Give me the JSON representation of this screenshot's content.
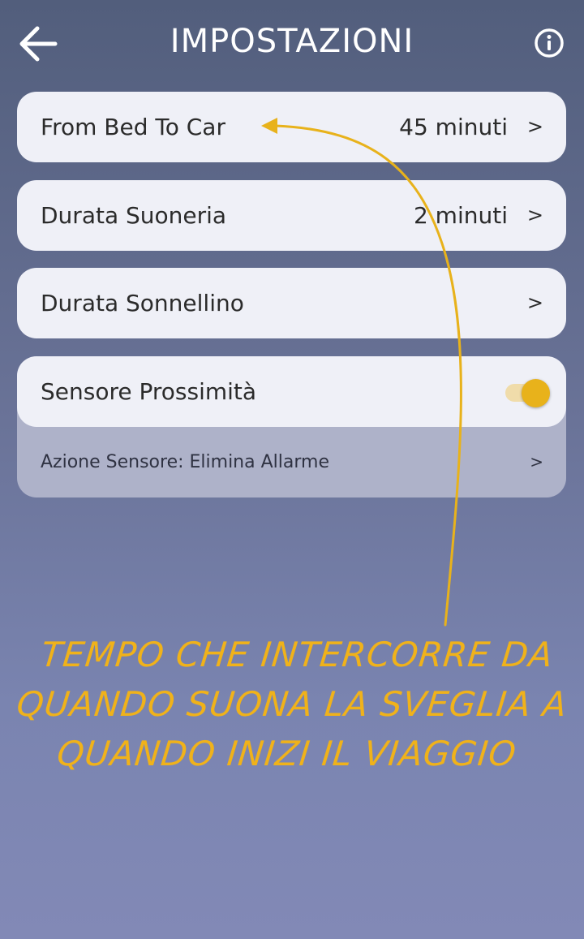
{
  "header": {
    "title": "IMPOSTAZIONI",
    "back_icon": "arrow-left-icon",
    "info_icon": "info-circle-icon"
  },
  "settings": [
    {
      "label": "From Bed To Car",
      "value": "45 minuti",
      "chevron": ">"
    },
    {
      "label": "Durata Suoneria",
      "value": "2 minuti",
      "chevron": ">"
    },
    {
      "label": "Durata Sonnellino",
      "value": "",
      "chevron": ">"
    }
  ],
  "sensor": {
    "label": "Sensore Prossimità",
    "toggle_on": true,
    "action_label": "Azione Sensore: Elimina Allarme",
    "action_chevron": ">"
  },
  "annotation": {
    "lines": [
      "TEMPO CHE INTERCORRE DA",
      "QUANDO SUONA LA SVEGLIA A",
      "QUANDO INIZI IL VIAGGIO"
    ],
    "arrow_icon": "curved-arrow-icon"
  },
  "colors": {
    "accent": "#e8b21b",
    "annotation": "#f0b21a",
    "card": "#eff0f7",
    "card_sub": "#aeb2c9"
  }
}
